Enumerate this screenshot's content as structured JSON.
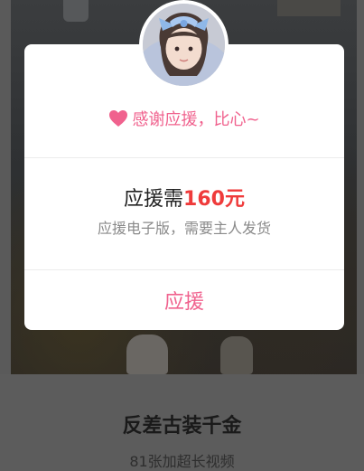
{
  "background": {
    "product_title": "反差古装千金",
    "product_subtitle": "81张加超长视频"
  },
  "modal": {
    "thanks_text": "感谢应援，比心~",
    "price_prefix": "应援需",
    "price_amount": "160元",
    "note": "应援电子版，需要主人发货",
    "action_label": "应援"
  },
  "colors": {
    "accent_pink": "#f0628e",
    "price_red": "#ef3b3b",
    "overlay": "#5a5a5a"
  },
  "icons": {
    "heart": "heart-icon",
    "avatar": "avatar"
  }
}
